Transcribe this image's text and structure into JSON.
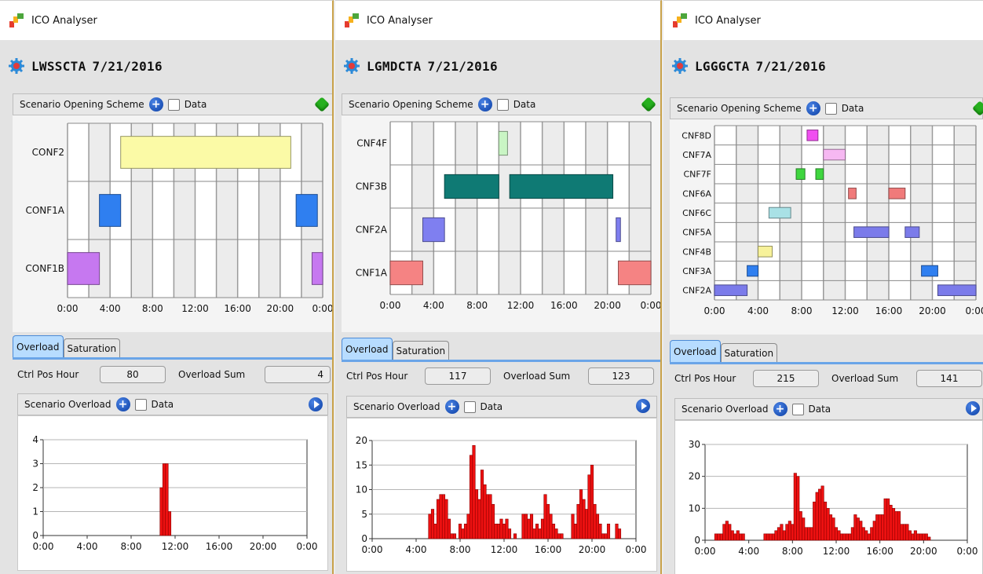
{
  "windows": [
    {
      "app_title": "ICO Analyser",
      "sector": "LWSSCTA",
      "date": "7/21/2016",
      "opening": {
        "label": "Scenario Opening Scheme",
        "data_label": "Data",
        "rows": [
          "CONF2",
          "CONF1A",
          "CONF1B"
        ],
        "x_ticks": [
          "0:00",
          "4:00",
          "8:00",
          "12:00",
          "16:00",
          "20:00",
          "0:00"
        ],
        "blocks": [
          {
            "row": "CONF2",
            "start": 5.0,
            "end": 21.0,
            "color": "#fbfaa6"
          },
          {
            "row": "CONF1A",
            "start": 3.0,
            "end": 5.0,
            "color": "#2f7ff0"
          },
          {
            "row": "CONF1A",
            "start": 21.5,
            "end": 23.5,
            "color": "#2f7ff0"
          },
          {
            "row": "CONF1B",
            "start": 0.0,
            "end": 3.0,
            "color": "#c678f0"
          },
          {
            "row": "CONF1B",
            "start": 23.0,
            "end": 24.0,
            "color": "#c678f0"
          }
        ]
      },
      "tabs": [
        "Overload",
        "Saturation"
      ],
      "ctrl_pos_hour_label": "Ctrl Pos Hour",
      "ctrl_pos_hour": "80",
      "overload_sum_label": "Overload Sum",
      "overload_sum": "4",
      "overload_panel_label": "Scenario Overload",
      "overload_data_label": "Data"
    },
    {
      "app_title": "ICO Analyser",
      "sector": "LGMDCTA",
      "date": "7/21/2016",
      "opening": {
        "label": "Scenario Opening Scheme",
        "data_label": "Data",
        "rows": [
          "CNF4F",
          "CNF3B",
          "CNF2A",
          "CNF1A"
        ],
        "x_ticks": [
          "0:00",
          "4:00",
          "8:00",
          "12:00",
          "16:00",
          "20:00",
          "0:00"
        ],
        "blocks": [
          {
            "row": "CNF4F",
            "start": 10.0,
            "end": 10.8,
            "color": "#c9f5c4"
          },
          {
            "row": "CNF3B",
            "start": 5.0,
            "end": 10.0,
            "color": "#0f7a74"
          },
          {
            "row": "CNF3B",
            "start": 11.0,
            "end": 20.5,
            "color": "#0f7a74"
          },
          {
            "row": "CNF2A",
            "start": 3.0,
            "end": 5.0,
            "color": "#7f7ff0"
          },
          {
            "row": "CNF2A",
            "start": 20.8,
            "end": 21.2,
            "color": "#7f7ff0"
          },
          {
            "row": "CNF1A",
            "start": 0.0,
            "end": 3.0,
            "color": "#f58383"
          },
          {
            "row": "CNF1A",
            "start": 21.0,
            "end": 24.0,
            "color": "#f58383"
          }
        ]
      },
      "tabs": [
        "Overload",
        "Saturation"
      ],
      "ctrl_pos_hour_label": "Ctrl Pos Hour",
      "ctrl_pos_hour": "117",
      "overload_sum_label": "Overload Sum",
      "overload_sum": "123",
      "overload_panel_label": "Scenario Overload",
      "overload_data_label": "Data"
    },
    {
      "app_title": "ICO Analyser",
      "sector": "LGGGCTA",
      "date": "7/21/2016",
      "opening": {
        "label": "Scenario Opening Scheme",
        "data_label": "Data",
        "rows": [
          "CNF8D",
          "CNF7A",
          "CNF7F",
          "CNF6A",
          "CNF6C",
          "CNF5A",
          "CNF4B",
          "CNF3A",
          "CNF2A"
        ],
        "x_ticks": [
          "0:00",
          "4:00",
          "8:00",
          "12:00",
          "16:00",
          "20:00",
          "0:00"
        ],
        "blocks": [
          {
            "row": "CNF8D",
            "start": 8.5,
            "end": 9.5,
            "color": "#f04ff0"
          },
          {
            "row": "CNF7A",
            "start": 10.0,
            "end": 12.0,
            "color": "#f6b8f2"
          },
          {
            "row": "CNF7F",
            "start": 7.5,
            "end": 8.3,
            "color": "#3fd63f"
          },
          {
            "row": "CNF7F",
            "start": 9.3,
            "end": 10.0,
            "color": "#3fd63f"
          },
          {
            "row": "CNF6A",
            "start": 12.3,
            "end": 13.0,
            "color": "#f07a7a"
          },
          {
            "row": "CNF6A",
            "start": 16.0,
            "end": 17.5,
            "color": "#f07a7a"
          },
          {
            "row": "CNF6C",
            "start": 5.0,
            "end": 7.0,
            "color": "#a9e1e6"
          },
          {
            "row": "CNF5A",
            "start": 12.8,
            "end": 16.0,
            "color": "#7b7bea"
          },
          {
            "row": "CNF5A",
            "start": 17.5,
            "end": 18.8,
            "color": "#7b7bea"
          },
          {
            "row": "CNF4B",
            "start": 4.0,
            "end": 5.3,
            "color": "#f7f29a"
          },
          {
            "row": "CNF3A",
            "start": 3.0,
            "end": 4.0,
            "color": "#2f7ff0"
          },
          {
            "row": "CNF3A",
            "start": 19.0,
            "end": 20.5,
            "color": "#2f7ff0"
          },
          {
            "row": "CNF2A",
            "start": 0.0,
            "end": 3.0,
            "color": "#7b7bea"
          },
          {
            "row": "CNF2A",
            "start": 20.5,
            "end": 24.0,
            "color": "#7b7bea"
          }
        ]
      },
      "tabs": [
        "Overload",
        "Saturation"
      ],
      "ctrl_pos_hour_label": "Ctrl Pos Hour",
      "ctrl_pos_hour": "215",
      "overload_sum_label": "Overload Sum",
      "overload_sum": "141",
      "overload_panel_label": "Scenario Overload",
      "overload_data_label": "Data"
    }
  ],
  "chart_data": [
    {
      "type": "bar",
      "title": "",
      "x_ticks": [
        "0:00",
        "4:00",
        "8:00",
        "12:00",
        "16:00",
        "20:00",
        "0:00"
      ],
      "y_ticks": [
        "0",
        "1",
        "2",
        "3",
        "4"
      ],
      "ylim": [
        0,
        4
      ],
      "x": [
        10.75,
        11.0,
        11.25,
        11.5
      ],
      "values": [
        2,
        3,
        3,
        1
      ],
      "color": "#ee1111"
    },
    {
      "type": "bar",
      "title": "",
      "x_ticks": [
        "0:00",
        "4:00",
        "8:00",
        "12:00",
        "16:00",
        "20:00",
        "0:00"
      ],
      "y_ticks": [
        "0",
        "5",
        "10",
        "15",
        "20"
      ],
      "ylim": [
        0,
        20
      ],
      "x": [
        5.25,
        5.5,
        5.75,
        6.0,
        6.25,
        6.5,
        6.75,
        7.0,
        7.25,
        7.5,
        8.0,
        8.25,
        8.5,
        8.75,
        9.0,
        9.25,
        9.5,
        9.75,
        10.0,
        10.25,
        10.5,
        10.75,
        11.0,
        11.25,
        11.5,
        11.75,
        12.0,
        12.25,
        12.5,
        13.0,
        13.75,
        14.0,
        14.25,
        14.5,
        14.75,
        15.0,
        15.25,
        15.5,
        15.75,
        16.0,
        16.25,
        16.5,
        16.75,
        17.0,
        17.25,
        18.25,
        18.5,
        18.75,
        19.0,
        19.25,
        19.5,
        19.75,
        20.0,
        20.25,
        20.5,
        20.75,
        21.0,
        21.25,
        21.5,
        22.25,
        22.5
      ],
      "values": [
        5,
        6,
        3,
        8,
        9,
        9,
        8,
        4,
        1,
        1,
        3,
        2,
        3,
        5,
        17,
        19,
        10,
        8,
        14,
        11,
        9,
        9,
        7,
        3,
        3,
        4,
        3,
        4,
        2,
        1,
        5,
        5,
        4,
        5,
        2,
        3,
        2,
        4,
        9,
        7,
        5,
        3,
        2,
        1,
        1,
        5,
        3,
        7,
        10,
        8,
        6,
        13,
        15,
        7,
        5,
        3,
        1,
        1,
        3,
        3,
        2
      ],
      "color": "#ee1111"
    },
    {
      "type": "bar",
      "title": "",
      "x_ticks": [
        "0:00",
        "4:00",
        "8:00",
        "12:00",
        "16:00",
        "20:00",
        "0:00"
      ],
      "y_ticks": [
        "0",
        "10",
        "20",
        "30"
      ],
      "ylim": [
        0,
        30
      ],
      "x": [
        1.0,
        1.25,
        1.5,
        1.75,
        2.0,
        2.25,
        2.5,
        2.75,
        3.0,
        3.25,
        3.5,
        5.5,
        5.75,
        6.0,
        6.25,
        6.5,
        6.75,
        7.0,
        7.25,
        7.5,
        7.75,
        8.0,
        8.25,
        8.5,
        8.75,
        9.0,
        9.25,
        9.5,
        9.75,
        10.0,
        10.25,
        10.5,
        10.75,
        11.0,
        11.25,
        11.5,
        11.75,
        12.0,
        12.25,
        12.5,
        12.75,
        13.0,
        13.25,
        13.5,
        13.75,
        14.0,
        14.25,
        14.5,
        14.75,
        15.0,
        15.25,
        15.5,
        15.75,
        16.0,
        16.25,
        16.5,
        16.75,
        17.0,
        17.25,
        17.5,
        17.75,
        18.0,
        18.25,
        18.5,
        18.75,
        19.0,
        19.25,
        19.5,
        19.75,
        20.0,
        20.25,
        20.5
      ],
      "values": [
        2,
        2,
        2,
        5,
        6,
        5,
        3,
        2,
        3,
        2,
        2,
        2,
        2,
        2,
        2,
        3,
        4,
        5,
        3,
        5,
        6,
        5,
        21,
        20,
        9,
        7,
        4,
        4,
        4,
        12,
        15,
        16,
        17,
        12,
        10,
        8,
        7,
        4,
        3,
        2,
        2,
        2,
        2,
        4,
        8,
        7,
        6,
        4,
        3,
        2,
        4,
        6,
        8,
        8,
        8,
        13,
        13,
        11,
        10,
        9,
        9,
        5,
        5,
        5,
        3,
        2,
        3,
        2,
        2,
        2,
        2,
        1
      ],
      "color": "#ee1111"
    }
  ]
}
